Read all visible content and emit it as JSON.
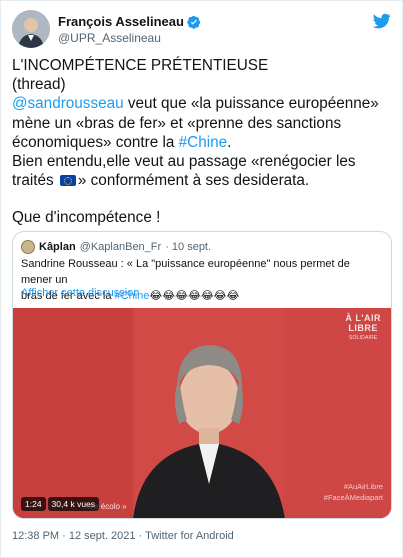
{
  "tweet": {
    "author_name": "François Asselineau",
    "author_handle": "@UPR_Asselineau",
    "text": {
      "line1": "L'INCOMPÉTENCE PRÉTENTIEUSE",
      "line2": "(thread)",
      "mention": "@sandrousseau",
      "line3_rest": " veut que «la puissance européenne»",
      "line4": "mène un «bras de fer» et «prenne des sanctions",
      "line5_pre": "économiques» contre la ",
      "hashtag_chine": "#Chine",
      "line5_post": ".",
      "line6": "Bien entendu,elle veut au passage «renégocier les",
      "line7_pre": "traités ",
      "line7_post": "» conformément à ses desiderata.",
      "line8": "Que d'incompétence !"
    },
    "timestamp": "12:38 PM · 12 sept. 2021 · Twitter for Android"
  },
  "quoted": {
    "author_name": "Kâplan",
    "author_handle": "@KaplanBen_Fr",
    "date": "· 10 sept.",
    "text_line1": "Sandrine Rousseau : « La \"puissance européenne\" nous permet de mener un",
    "text_line2_pre": "bras de fer avec la ",
    "hashtag": "#Chine",
    "emoji": "😂😂😂😂😂😂😂",
    "show_thread": "Afficher cette discussion"
  },
  "video": {
    "brand_line1": "À L'AIR",
    "brand_line2": "LIBRE",
    "brand_sub": "SOLIDAIRE",
    "hashtag1": "#AuAirLibre",
    "hashtag2": "#FaceÀMediapart",
    "lower_third": "...t e écolo »",
    "duration": "1:24",
    "views": "30,4 k vues"
  },
  "colors": {
    "accent": "#1d9bf0",
    "video_background": "#d24a46",
    "verified": "#1d9bf0"
  },
  "icons": [
    "verified-badge-icon",
    "twitter-logo-icon",
    "eu-flag-icon"
  ]
}
